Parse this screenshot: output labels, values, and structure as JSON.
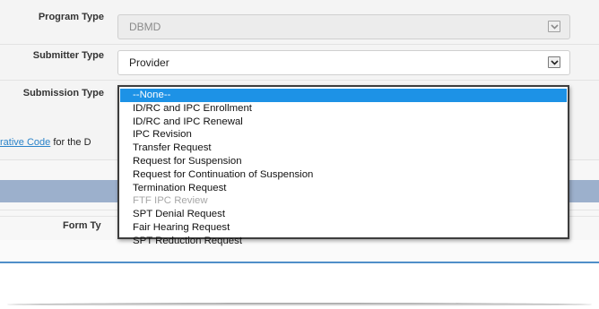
{
  "form": {
    "program_type": {
      "label": "Program Type",
      "value": "DBMD"
    },
    "submitter_type": {
      "label": "Submitter Type",
      "value": "Provider"
    },
    "submission_type": {
      "label": "Submission Type",
      "options": [
        {
          "label": "--None--",
          "selected": true,
          "disabled": false
        },
        {
          "label": "ID/RC and IPC Enrollment",
          "selected": false,
          "disabled": false
        },
        {
          "label": "ID/RC and IPC Renewal",
          "selected": false,
          "disabled": false
        },
        {
          "label": "IPC Revision",
          "selected": false,
          "disabled": false
        },
        {
          "label": "Transfer Request",
          "selected": false,
          "disabled": false
        },
        {
          "label": "Request for Suspension",
          "selected": false,
          "disabled": false
        },
        {
          "label": "Request for Continuation of Suspension",
          "selected": false,
          "disabled": false
        },
        {
          "label": "Termination Request",
          "selected": false,
          "disabled": false
        },
        {
          "label": "FTF IPC Review",
          "selected": false,
          "disabled": true
        },
        {
          "label": "SPT Denial Request",
          "selected": false,
          "disabled": false
        },
        {
          "label": "Fair Hearing Request",
          "selected": false,
          "disabled": false
        },
        {
          "label": "SPT Reduction Request",
          "selected": false,
          "disabled": false
        }
      ]
    }
  },
  "note": {
    "link_text": "rative Code",
    "text_after": " for the D"
  },
  "table": {
    "form_type_header": "Form Ty"
  },
  "colors": {
    "selected_option": "#1d92e6",
    "section_bar": "#9cb0cc",
    "link": "#2a83c9",
    "divider": "#4f8fc9"
  },
  "icons": {
    "dropdown_arrow": "chevron-down-icon"
  }
}
